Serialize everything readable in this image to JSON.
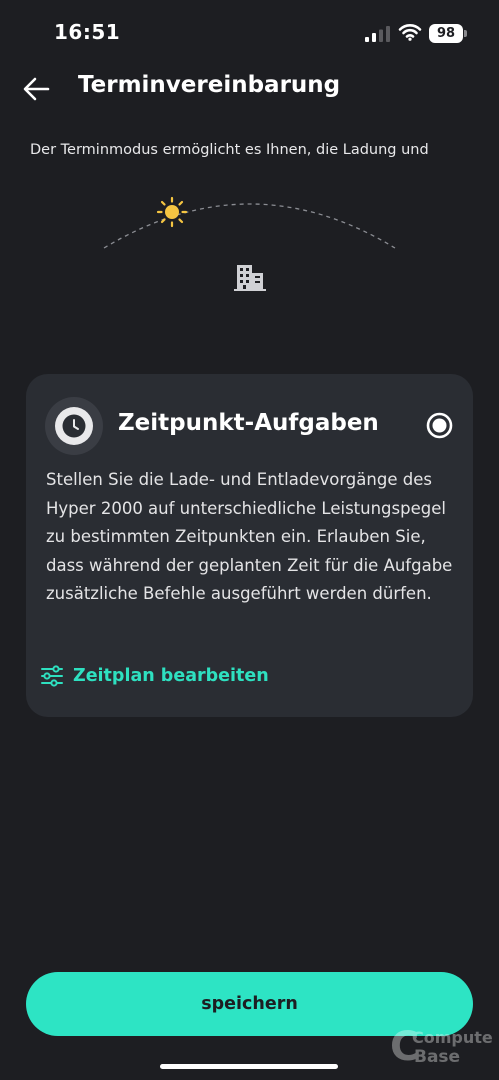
{
  "status_bar": {
    "time": "16:51",
    "battery": "98"
  },
  "header": {
    "title": "Terminvereinbarung"
  },
  "intro_text": "Der Terminmodus ermöglicht es Ihnen, die Ladung und",
  "card": {
    "title": "Zeitpunkt-Aufgaben",
    "description": "Stellen Sie die Lade- und Entladevorgänge des Hyper 2000 auf unterschiedliche Leistungspegel zu bestimmten Zeitpunkten ein. Erlauben Sie, dass während der geplanten Zeit für die Aufgabe zusätzliche Befehle ausgeführt werden dürfen.",
    "edit_label": "Zeitplan bearbeiten",
    "selected": true
  },
  "save_label": "speichern",
  "watermark": {
    "line1": "Computer",
    "line2": "Base"
  },
  "icons": {
    "back": "arrow-left-icon",
    "sun": "sun-icon",
    "building": "building-icon",
    "clock": "clock-icon",
    "edit": "sliders-icon"
  },
  "colors": {
    "background": "#1d1e22",
    "card": "#2a2d33",
    "accent": "#2de4c4",
    "sun": "#f5c542"
  }
}
